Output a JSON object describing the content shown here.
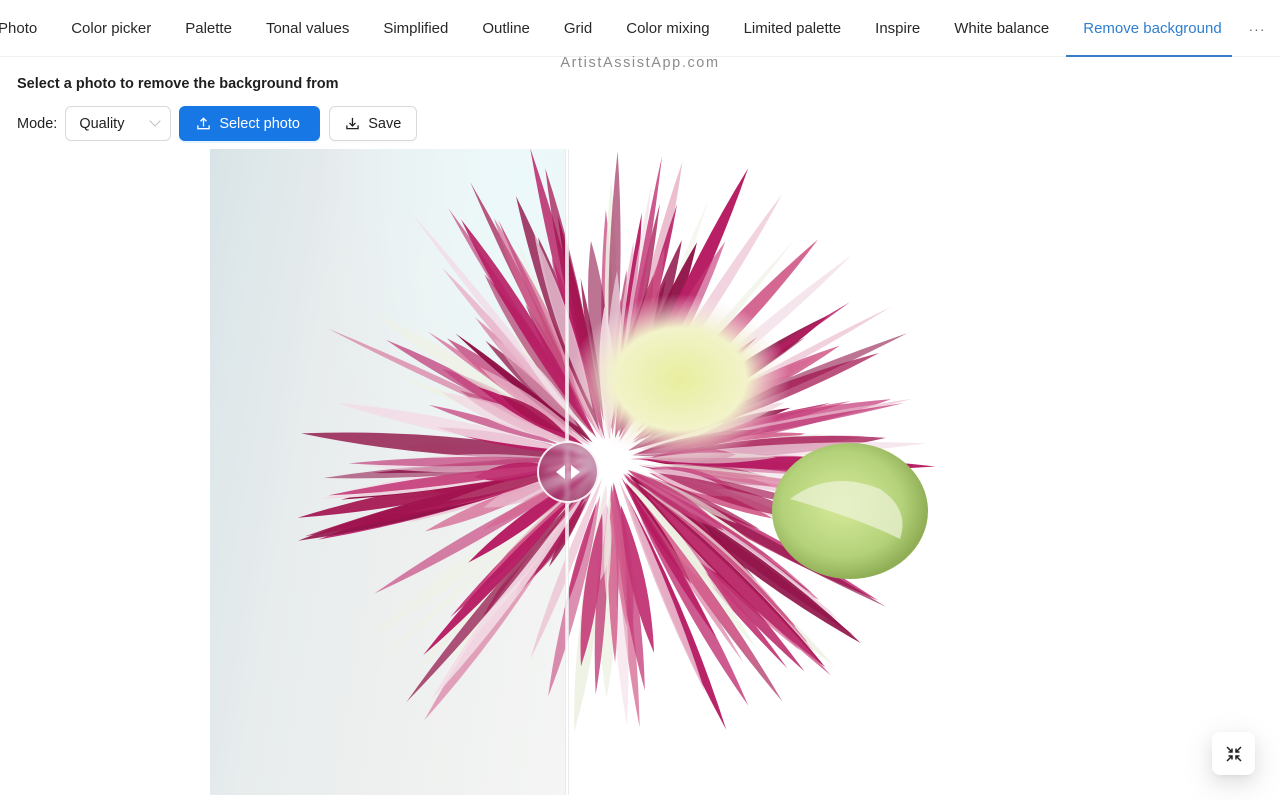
{
  "tabs": [
    {
      "label": "Photo",
      "active": false
    },
    {
      "label": "Color picker",
      "active": false
    },
    {
      "label": "Palette",
      "active": false
    },
    {
      "label": "Tonal values",
      "active": false
    },
    {
      "label": "Simplified",
      "active": false
    },
    {
      "label": "Outline",
      "active": false
    },
    {
      "label": "Grid",
      "active": false
    },
    {
      "label": "Color mixing",
      "active": false
    },
    {
      "label": "Limited palette",
      "active": false
    },
    {
      "label": "Inspire",
      "active": false
    },
    {
      "label": "White balance",
      "active": false
    },
    {
      "label": "Remove background",
      "active": true
    }
  ],
  "more_label": "···",
  "watermark": "ArtistAssistApp.com",
  "page": {
    "title": "Select a photo to remove the background from",
    "mode_label": "Mode:",
    "mode_value": "Quality",
    "select_photo_label": "Select photo",
    "save_label": "Save"
  },
  "colors": {
    "accent": "#1677e5",
    "active_tab": "#2f7fd0",
    "petal_magenta": "#b0195e",
    "petal_light": "#f3dbe6",
    "center_yellow": "#eef2b8",
    "bud_green": "#b8d77a"
  },
  "icons": {
    "upload": "upload-icon",
    "download": "download-icon",
    "compare_handle": "left-right-arrows-icon",
    "fullscreen_exit": "fullscreen-exit-icon",
    "chevron": "chevron-down-icon"
  }
}
